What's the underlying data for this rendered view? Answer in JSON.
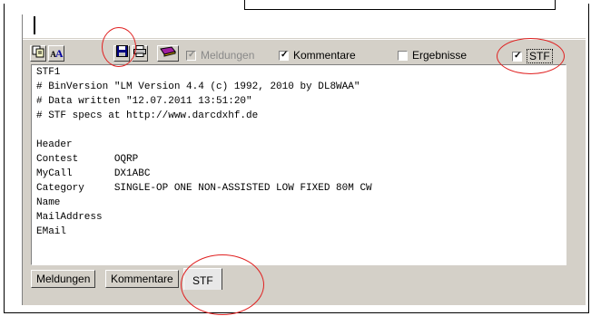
{
  "toolbar": {
    "buttons": [
      {
        "name": "copy-icon"
      },
      {
        "name": "font-size-icon",
        "label": "AA"
      },
      {
        "name": "save-icon"
      },
      {
        "name": "print-icon"
      },
      {
        "name": "eraser-icon"
      }
    ],
    "checkboxes": [
      {
        "label": "Meldungen",
        "checked": true,
        "disabled": true
      },
      {
        "label": "Kommentare",
        "checked": true,
        "disabled": false
      },
      {
        "label": "Ergebnisse",
        "checked": false,
        "disabled": false
      },
      {
        "label": "STF",
        "checked": true,
        "disabled": false
      }
    ]
  },
  "content": {
    "lines": [
      "STF1",
      "# BinVersion \"LM Version 4.4 (c) 1992, 2010 by DL8WAA\"",
      "# Data written \"12.07.2011 13:51:20\"",
      "# STF specs at http://www.darcdxhf.de",
      "",
      "Header",
      "Contest      OQRP",
      "MyCall       DX1ABC",
      "Category     SINGLE-OP ONE NON-ASSISTED LOW FIXED 80M CW",
      "Name",
      "MailAddress",
      "EMail"
    ]
  },
  "tabs": [
    {
      "label": "Meldungen",
      "active": false
    },
    {
      "label": "Kommentare",
      "active": false
    },
    {
      "label": "STF",
      "active": true
    }
  ],
  "colors": {
    "annotation": "#e02020",
    "window_bg": "#d4d0c8"
  }
}
